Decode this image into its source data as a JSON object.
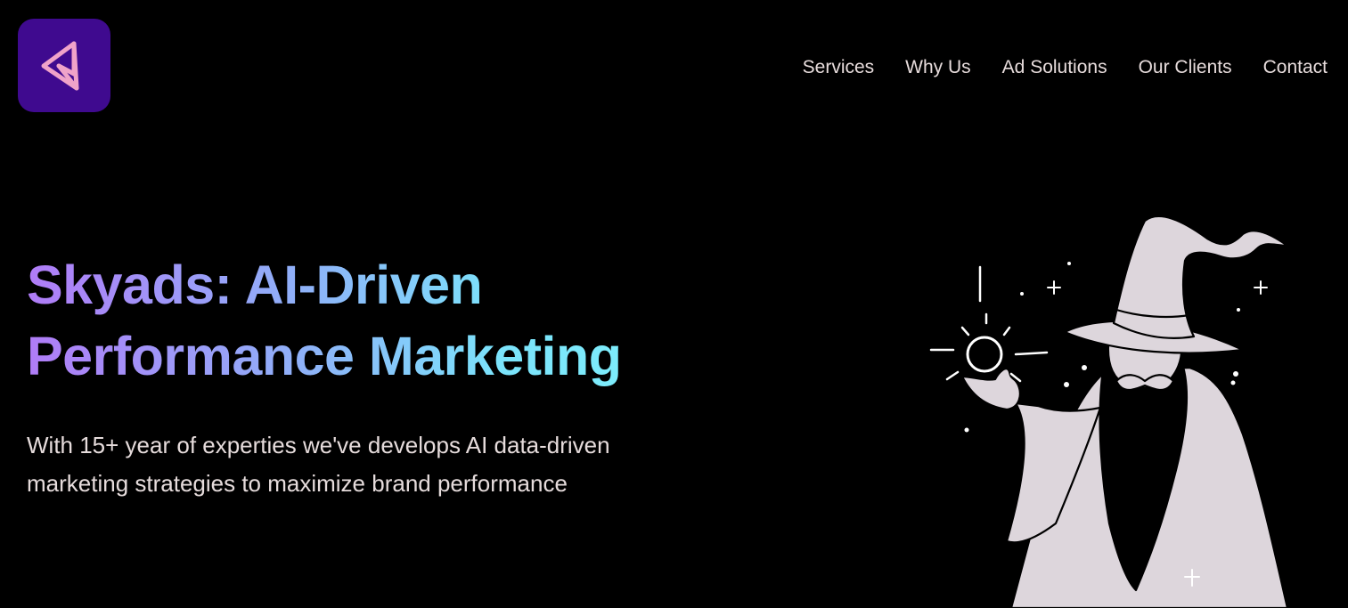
{
  "header": {
    "logo_icon": "triangle-logo-icon",
    "nav": [
      {
        "label": "Services"
      },
      {
        "label": "Why Us"
      },
      {
        "label": "Ad Solutions"
      },
      {
        "label": "Our Clients"
      },
      {
        "label": "Contact"
      }
    ]
  },
  "hero": {
    "title_line1": "Skyads: AI-Driven",
    "title_line2": "Performance Marketing",
    "subtitle_line1": "With 15+ year of experties we've develops AI data-driven",
    "subtitle_line2": "marketing strategies to maximize brand performance",
    "illustration": "wizard-with-orb-illustration"
  },
  "colors": {
    "background": "#000000",
    "logo_bg": "#3f0a8f",
    "logo_mark": "#f0a3c9",
    "nav_text": "#e7dcdc",
    "gradient_start": "#b07cf7",
    "gradient_end": "#7ef2fb",
    "wizard_fill": "#ddd6dc"
  }
}
